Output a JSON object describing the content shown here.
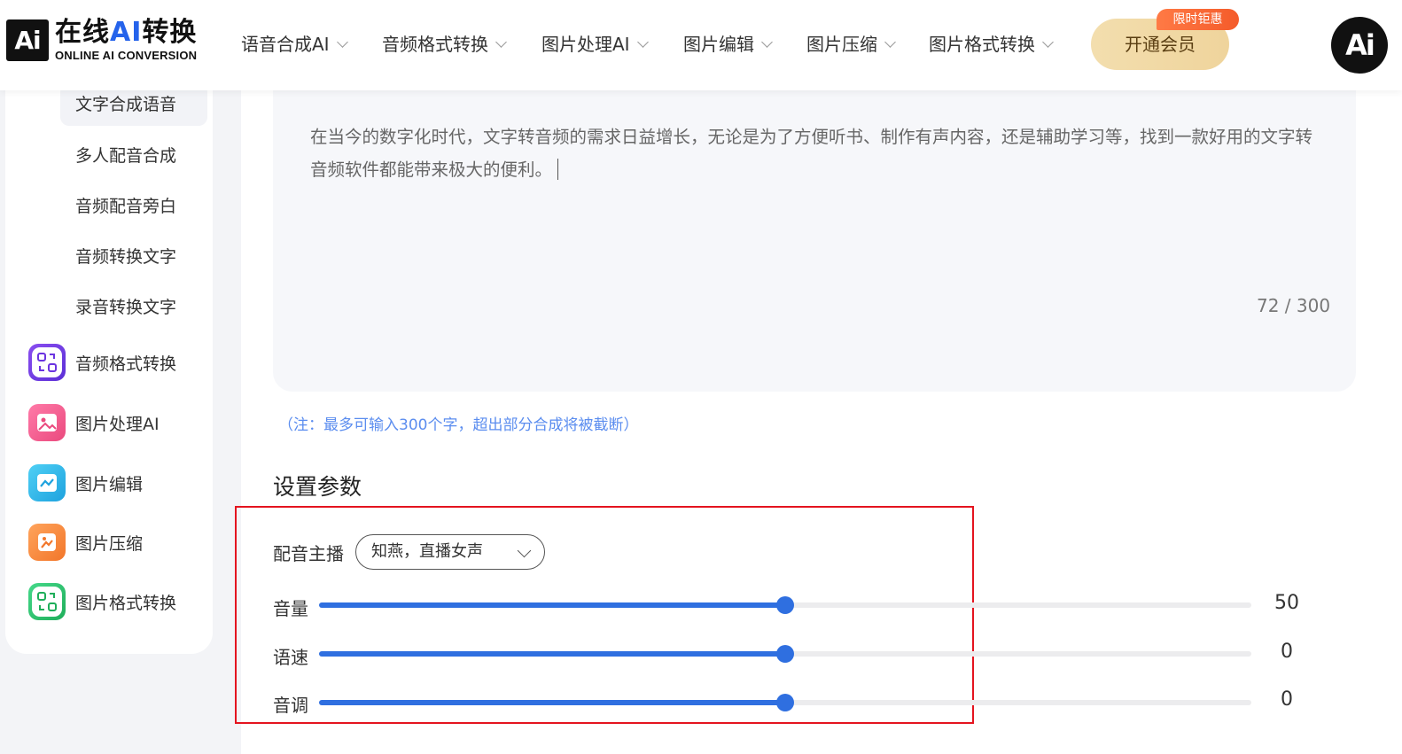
{
  "header": {
    "logo_mark": "Ai",
    "logo_name_prefix": "在线",
    "logo_name_ai": "AI",
    "logo_name_suffix": "转换",
    "logo_sub": "ONLINE AI CONVERSION",
    "nav": [
      {
        "label": "语音合成AI"
      },
      {
        "label": "音频格式转换"
      },
      {
        "label": "图片处理AI"
      },
      {
        "label": "图片编辑"
      },
      {
        "label": "图片压缩"
      },
      {
        "label": "图片格式转换"
      }
    ],
    "vip_label": "开通会员",
    "vip_badge": "限时钜惠",
    "avatar_text": "Ai"
  },
  "sidebar": {
    "sub_items": [
      {
        "label": "文字合成语音"
      },
      {
        "label": "多人配音合成"
      },
      {
        "label": "音频配音旁白"
      },
      {
        "label": "音频转换文字"
      },
      {
        "label": "录音转换文字"
      }
    ],
    "items": [
      {
        "label": "音频格式转换",
        "color": "#7b3fe4"
      },
      {
        "label": "图片处理AI",
        "color": "#f25b8f"
      },
      {
        "label": "图片编辑",
        "color": "#2db6e8"
      },
      {
        "label": "图片压缩",
        "color": "#f7893b"
      },
      {
        "label": "图片格式转换",
        "color": "#2bc46a"
      }
    ]
  },
  "editor": {
    "text": "在当今的数字化时代，文字转音频的需求日益增长，无论是为了方便听书、制作有声内容，还是辅助学习等，找到一款好用的文字转音频软件都能带来极大的便利。",
    "counter": "72 / 300",
    "note": "（注：最多可输入300个字，超出部分合成将被截断）"
  },
  "settings": {
    "title": "设置参数",
    "voice_label": "配音主播",
    "voice_value": "知燕，直播女声",
    "sliders": [
      {
        "label": "音量",
        "value": "50",
        "fraction": 0.5
      },
      {
        "label": "语速",
        "value": "0",
        "fraction": 0.5
      },
      {
        "label": "音调",
        "value": "0",
        "fraction": 0.5
      }
    ]
  },
  "colors": {
    "accent": "#2f6fe0",
    "highlight_border": "#e4141f",
    "vip_gold": "#f3deae",
    "badge_orange": "#f45b2a"
  }
}
